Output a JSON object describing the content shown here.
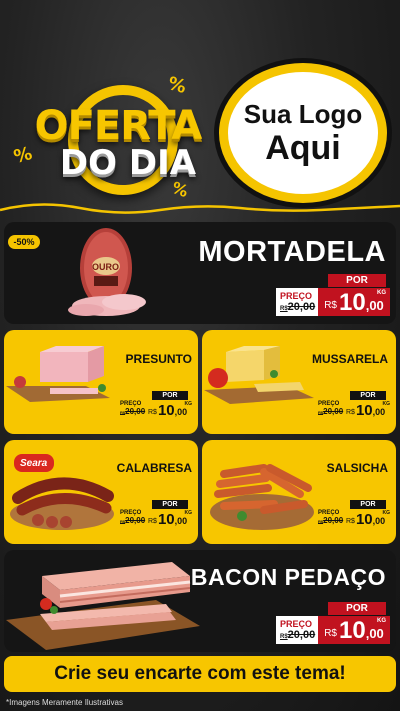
{
  "header": {
    "oferta_line1": "OFERTA",
    "oferta_line2": "DO DIA",
    "percent_symbol": "%",
    "logo_line1": "Sua Logo",
    "logo_line2": "Aqui"
  },
  "colors": {
    "accent": "#f7c600",
    "price_red": "#c1121f",
    "background": "#1b1b1b"
  },
  "featured": {
    "discount_badge": "-50%",
    "product_brand": "OURO",
    "title": "MORTADELA",
    "por_label": "POR",
    "preco_label": "PREÇO",
    "old_price": "20,00",
    "old_currency": "R$",
    "currency": "R$",
    "price": "10",
    "cents": ",00",
    "unit": "KG"
  },
  "products": [
    {
      "title": "PRESUNTO",
      "por_label": "POR",
      "preco_label": "PREÇO",
      "old_price": "20,00",
      "old_currency": "R$",
      "currency": "R$",
      "price": "10",
      "cents": ",00",
      "unit": "KG"
    },
    {
      "title": "MUSSARELA",
      "por_label": "POR",
      "preco_label": "PREÇO",
      "old_price": "20,00",
      "old_currency": "R$",
      "currency": "R$",
      "price": "10",
      "cents": ",00",
      "unit": "KG"
    },
    {
      "title": "CALABRESA",
      "brand": "Seara",
      "por_label": "POR",
      "preco_label": "PREÇO",
      "old_price": "20,00",
      "old_currency": "R$",
      "currency": "R$",
      "price": "10",
      "cents": ",00",
      "unit": "KG"
    },
    {
      "title": "SALSICHA",
      "por_label": "POR",
      "preco_label": "PREÇO",
      "old_price": "20,00",
      "old_currency": "R$",
      "currency": "R$",
      "price": "10",
      "cents": ",00",
      "unit": "KG"
    }
  ],
  "bacon": {
    "title": "BACON PEDAÇO",
    "por_label": "POR",
    "preco_label": "PREÇO",
    "old_price": "20,00",
    "old_currency": "R$",
    "currency": "R$",
    "price": "10",
    "cents": ",00",
    "unit": "KG"
  },
  "cta": {
    "text": "Crie seu encarte com este tema!"
  },
  "footer": {
    "disclaimer": "*Imagens Meramente Ilustrativas"
  }
}
